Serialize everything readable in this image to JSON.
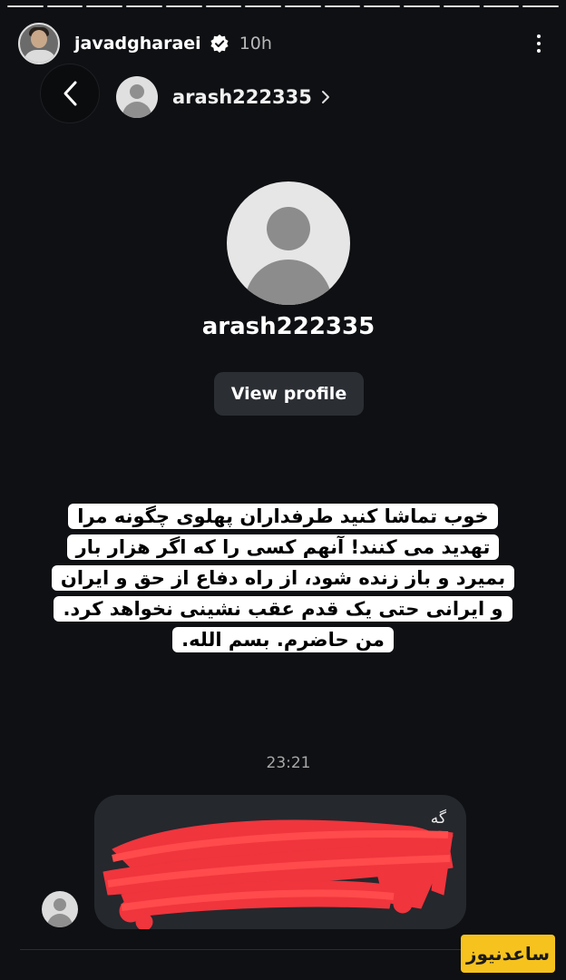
{
  "story": {
    "segment_count": 14,
    "username": "javadgharaei",
    "time": "10h",
    "verified": true,
    "icons": {
      "verified": "verified-badge-icon",
      "more": "more-options-icon"
    }
  },
  "dm_header": {
    "username": "arash222335",
    "icons": {
      "back": "chevron-left-icon",
      "forward": "chevron-right-icon"
    }
  },
  "profile": {
    "username": "arash222335",
    "view_profile_label": "View profile"
  },
  "overlay_text": {
    "lines": [
      "خوب تماشا کنید طرفداران پهلوی چگونه مرا",
      "تهدید می کنند! آنهم کسی را که اگر هزار بار",
      "بمیرد و باز زنده شود، از راه دفاع از حق و ایران",
      "و ایرانی حتی یک قدم عقب نشینی نخواهد کرد.",
      "من حاضرم. بسم الله."
    ]
  },
  "chat": {
    "timestamp": "23:21",
    "message_visible_fragment": "گه",
    "redacted": true,
    "colors": {
      "redaction": "#f0353d",
      "bubble": "#25282d"
    }
  },
  "watermark": {
    "text": "ساعدنیوز",
    "color": "#f6c21d"
  }
}
